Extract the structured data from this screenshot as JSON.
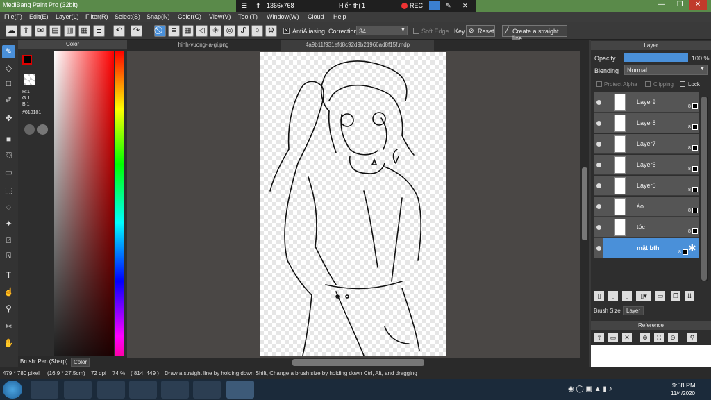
{
  "window": {
    "title": "MediBang Paint Pro (32bit)"
  },
  "recording": {
    "resolution": "1366x768",
    "display": "Hiển thị 1",
    "rec_label": "REC"
  },
  "menu": [
    "File(F)",
    "Edit(E)",
    "Layer(L)",
    "Filter(R)",
    "Select(S)",
    "Snap(N)",
    "Color(C)",
    "View(V)",
    "Tool(T)",
    "Window(W)",
    "Cloud",
    "Help"
  ],
  "toolbar": {
    "antialiasing": "AntiAliasing",
    "correction_label": "Correction",
    "correction_value": "34",
    "soft_edge": "Soft Edge",
    "key": "Key",
    "reset": "Reset",
    "straight_line": "Create a straight line"
  },
  "color": {
    "panel_title": "Color",
    "r": "R:1",
    "g": "G:1",
    "b": "B:1",
    "hex": "#010101"
  },
  "tabs": [
    "hinh-vuong-la-gi.png",
    "4a9b11f931efd8c92d9b21966ad8f15f.mdp"
  ],
  "layer_panel": {
    "title": "Layer",
    "opacity_label": "Opacity",
    "opacity_value": "100 %",
    "opacity_fraction": 1.0,
    "blending_label": "Blending",
    "blending_value": "Normal",
    "protect_alpha": "Protect Alpha",
    "clipping": "Clipping",
    "lock": "Lock",
    "layers": [
      {
        "name": "Layer9",
        "bits": "8"
      },
      {
        "name": "Layer8",
        "bits": "8"
      },
      {
        "name": "Layer7",
        "bits": "8"
      },
      {
        "name": "Layer6",
        "bits": "8"
      },
      {
        "name": "Layer5",
        "bits": "8"
      },
      {
        "name": "áo",
        "bits": "8"
      },
      {
        "name": "tóc",
        "bits": "8"
      },
      {
        "name": "mặt bth",
        "bits": "8"
      }
    ],
    "brush_size_tab": "Brush Size",
    "layer_tab": "Layer"
  },
  "reference": {
    "title": "Reference"
  },
  "bottom_tabs": {
    "brush": "Brush: Pen (Sharp)",
    "color": "Color"
  },
  "status": {
    "size": "479 * 780 pixel",
    "cm": "(16.9 * 27.5cm)",
    "dpi": "72 dpi",
    "zoom": "74 %",
    "coords": "( 814, 449 )",
    "hint": "Draw a straight line by holding down Shift, Change a brush size by holding down Ctrl, Alt, and dragging"
  },
  "clock": {
    "time": "9:58 PM",
    "date": "11/4/2020"
  }
}
